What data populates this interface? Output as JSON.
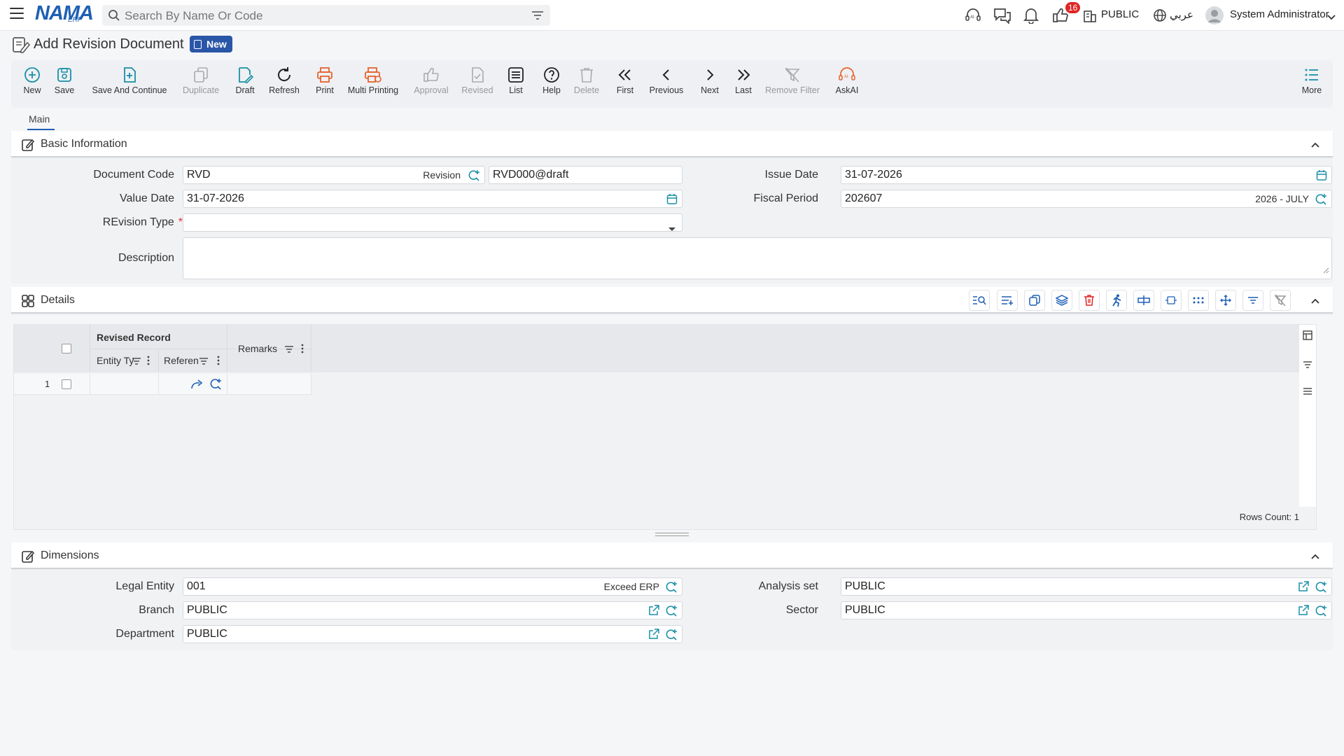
{
  "header": {
    "logo": "NAMA",
    "logo_sub": "ERP",
    "search_placeholder": "Search By Name Or Code",
    "notification_count": "16",
    "branch": "PUBLIC",
    "language": "عربي",
    "user": "System Administrator"
  },
  "page": {
    "title": "Add Revision Document",
    "status": "New"
  },
  "toolbar": [
    {
      "label": "New",
      "icon": "plus-circle-icon",
      "state": "active"
    },
    {
      "label": "Save",
      "icon": "save-icon",
      "state": "active"
    },
    {
      "label": "Save And Continue",
      "icon": "save-continue-icon",
      "state": "active"
    },
    {
      "label": "Duplicate",
      "icon": "duplicate-icon",
      "state": "disabled"
    },
    {
      "label": "Draft",
      "icon": "draft-icon",
      "state": "active"
    },
    {
      "label": "Refresh",
      "icon": "refresh-icon",
      "state": "active"
    },
    {
      "label": "Print",
      "icon": "print-icon",
      "state": "active"
    },
    {
      "label": "Multi Printing",
      "icon": "multi-print-icon",
      "state": "active"
    },
    {
      "label": "Approval",
      "icon": "approval-icon",
      "state": "disabled"
    },
    {
      "label": "Revised",
      "icon": "revised-icon",
      "state": "disabled"
    },
    {
      "label": "List",
      "icon": "list-icon",
      "state": "active"
    },
    {
      "label": "Help",
      "icon": "help-icon",
      "state": "active"
    },
    {
      "label": "Delete",
      "icon": "delete-icon",
      "state": "disabled"
    },
    {
      "label": "First",
      "icon": "first-icon",
      "state": "active"
    },
    {
      "label": "Previous",
      "icon": "previous-icon",
      "state": "active"
    },
    {
      "label": "Next",
      "icon": "next-icon",
      "state": "active"
    },
    {
      "label": "Last",
      "icon": "last-icon",
      "state": "active"
    },
    {
      "label": "Remove Filter",
      "icon": "remove-filter-icon",
      "state": "disabled"
    },
    {
      "label": "AskAI",
      "icon": "askai-icon",
      "state": "active"
    },
    {
      "label": "More",
      "icon": "more-icon",
      "state": "active"
    }
  ],
  "tabs": [
    {
      "label": "Main",
      "active": true
    }
  ],
  "basic_info": {
    "title": "Basic Information",
    "document_code": {
      "label": "Document Code",
      "value": "RVD",
      "suffix": "Revision",
      "code": "RVD000@draft"
    },
    "issue_date": {
      "label": "Issue Date",
      "value": "31-07-2026"
    },
    "value_date": {
      "label": "Value Date",
      "value": "31-07-2026"
    },
    "fiscal_period": {
      "label": "Fiscal Period",
      "value": "202607",
      "suffix": "2026 - JULY"
    },
    "revision_type": {
      "label": "REvision Type",
      "required": "*",
      "value": ""
    },
    "description": {
      "label": "Description",
      "value": ""
    }
  },
  "details": {
    "title": "Details",
    "group_header": "Revised Record",
    "columns": [
      "Entity Ty",
      "Referen",
      "Remarks"
    ],
    "rows": [
      {
        "num": "1"
      }
    ],
    "rows_count": "Rows Count: 1"
  },
  "dimensions": {
    "title": "Dimensions",
    "legal_entity": {
      "label": "Legal Entity",
      "value": "001",
      "suffix": "Exceed ERP"
    },
    "analysis_set": {
      "label": "Analysis set",
      "value": "PUBLIC"
    },
    "branch": {
      "label": "Branch",
      "value": "PUBLIC"
    },
    "sector": {
      "label": "Sector",
      "value": "PUBLIC"
    },
    "department": {
      "label": "Department",
      "value": "PUBLIC"
    }
  },
  "colors": {
    "brand": "#1e5fb4",
    "accent_orange": "#e8622c",
    "badge_red": "#e02424",
    "teal_icon": "#1a8fa8"
  }
}
